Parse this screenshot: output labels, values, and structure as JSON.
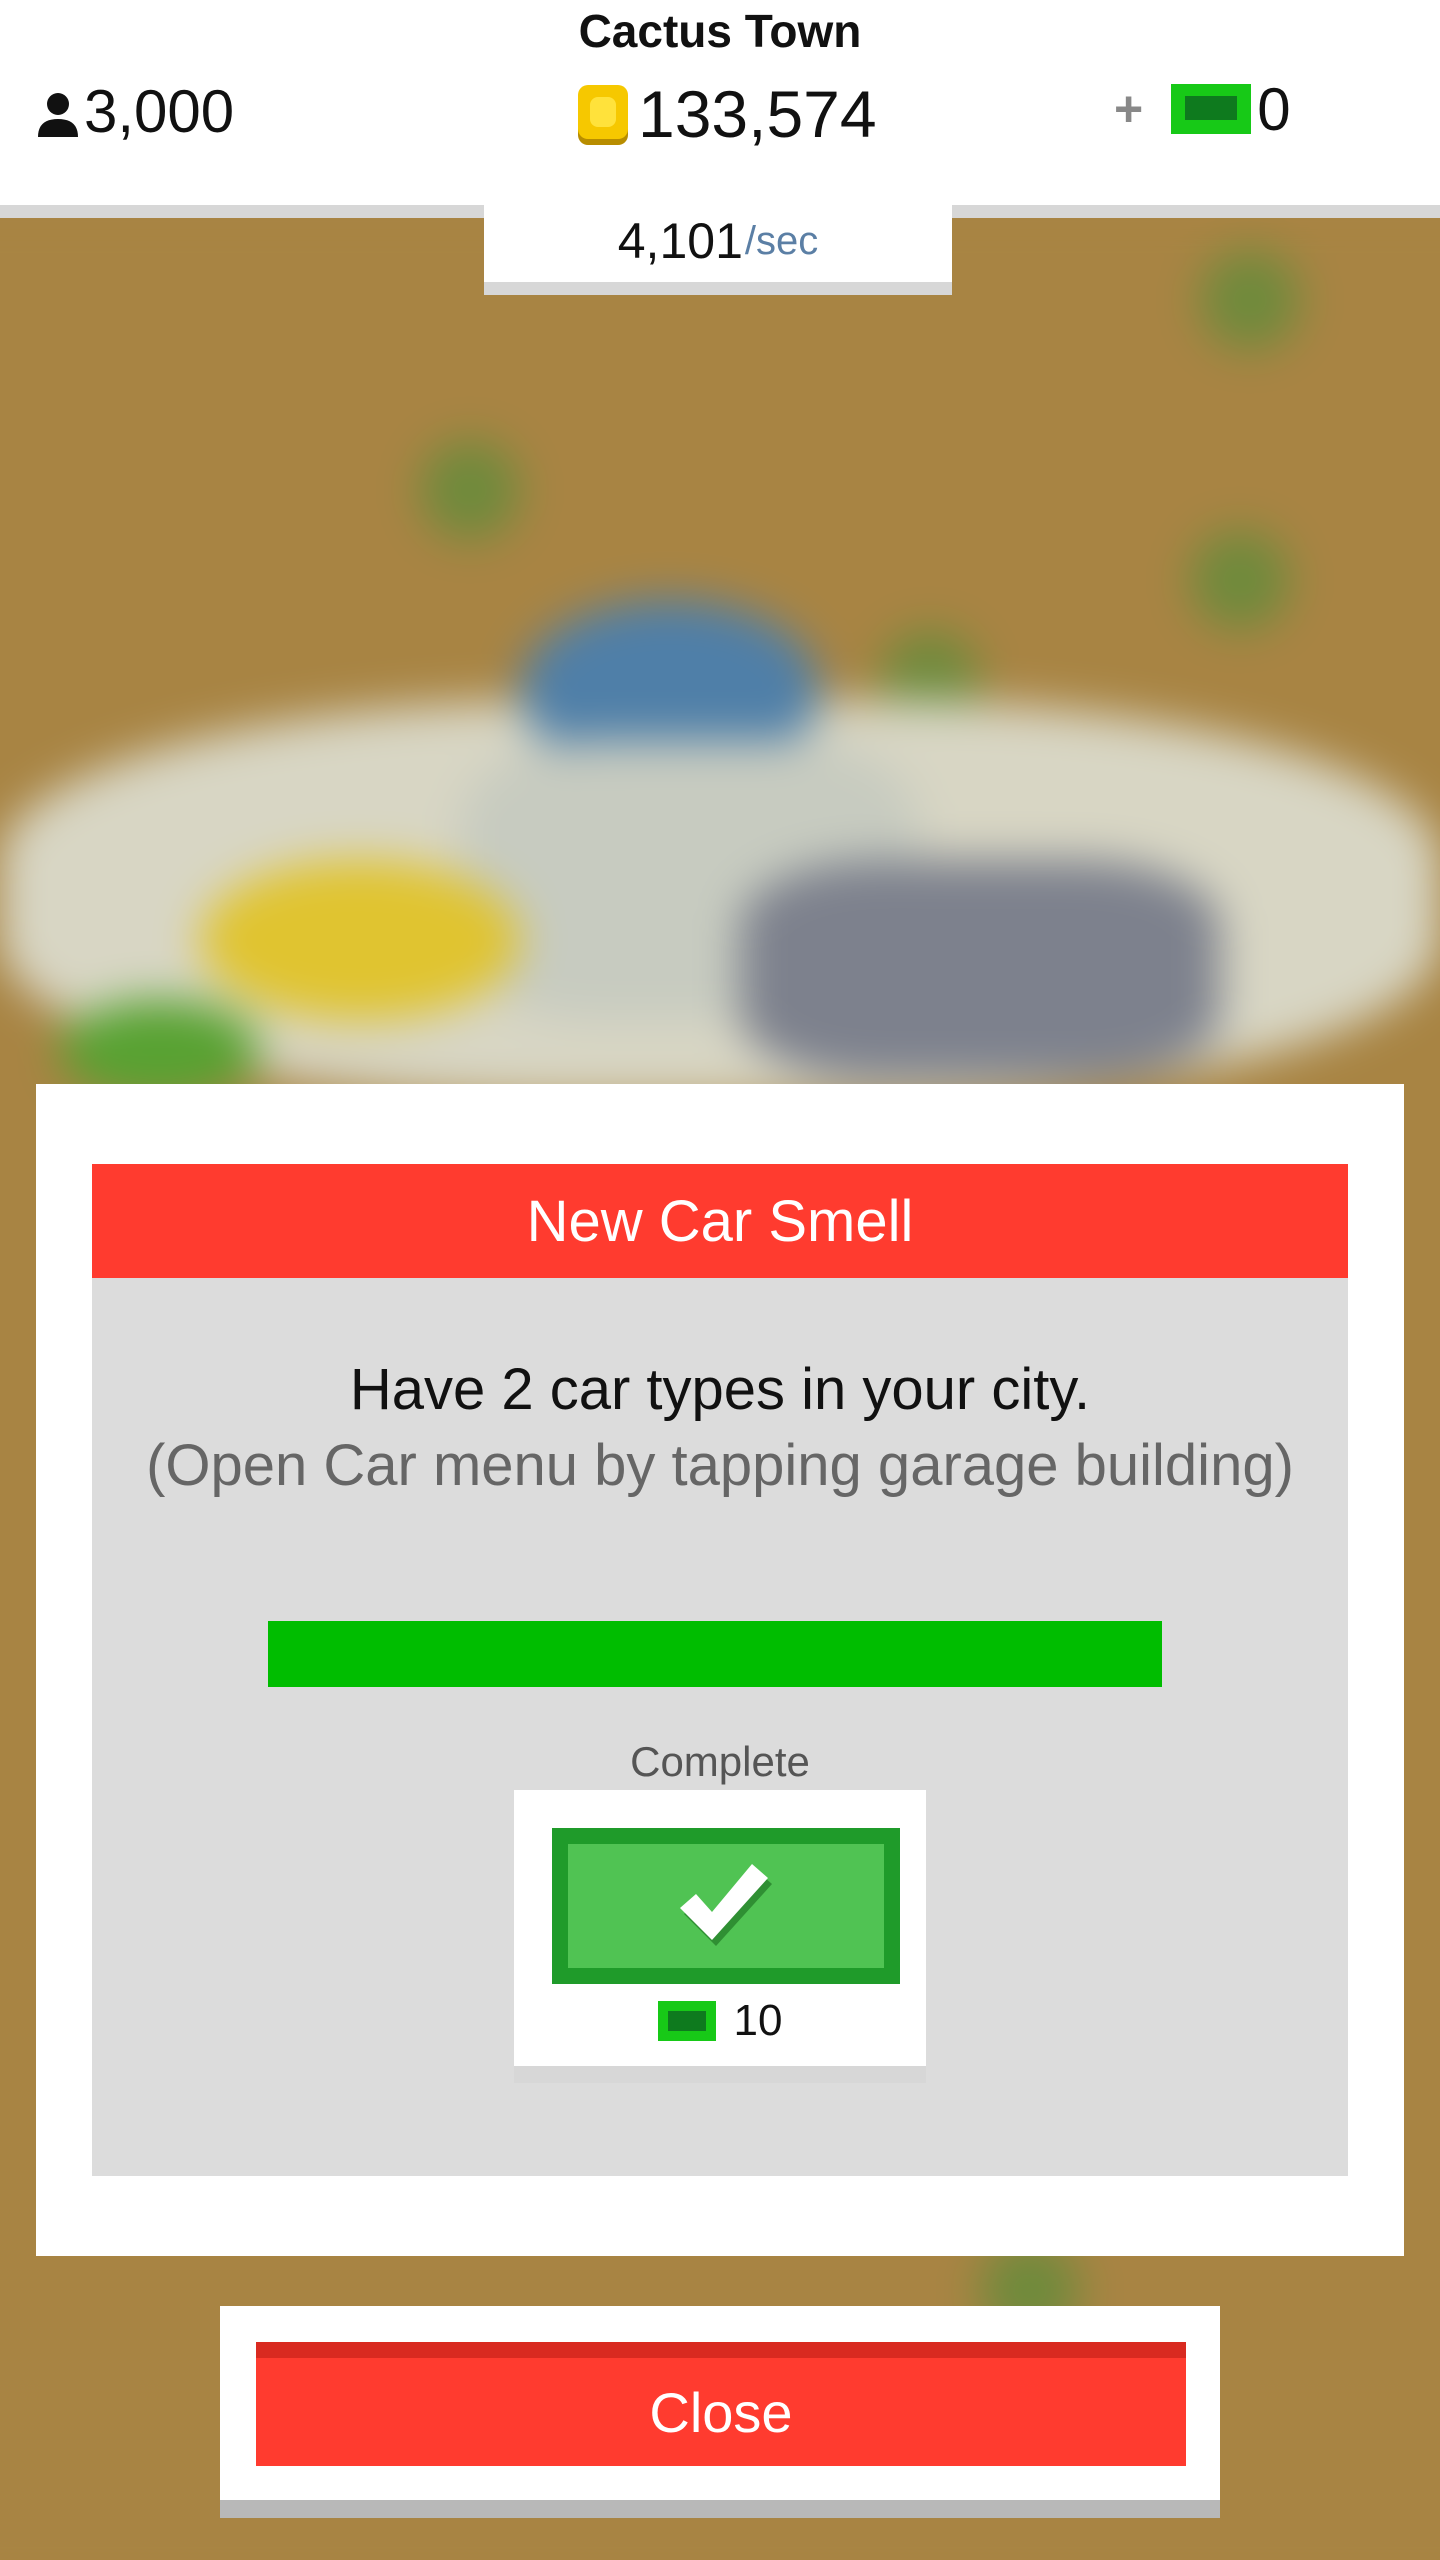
{
  "hud": {
    "city_name": "Cactus Town",
    "population": "3,000",
    "coins": "133,574",
    "cash_plus": "+",
    "cash": "0",
    "rate_value": "4,101",
    "rate_unit": "/sec"
  },
  "mission": {
    "title": "New Car Smell",
    "description": "Have 2 car types in your city.",
    "hint": "(Open Car menu by tapping garage building)",
    "progress_fraction": 1.0,
    "status": "Complete",
    "reward_amount": "10"
  },
  "close_label": "Close",
  "colors": {
    "header_red": "#ff3b2f",
    "progress_green": "#00bd00",
    "button_green": "#50c353",
    "coin_yellow": "#f6c800",
    "cash_green": "#17c917",
    "ground": "#a98445"
  },
  "icons": {
    "population": "person-icon",
    "coins": "coin-icon",
    "cash": "cash-icon",
    "claim": "checkmark-icon"
  }
}
